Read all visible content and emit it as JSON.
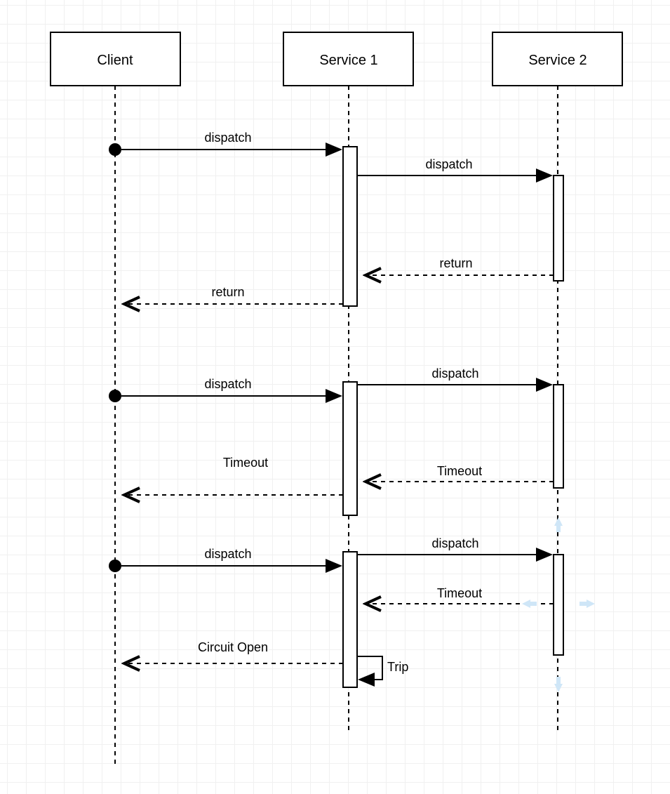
{
  "participants": {
    "client": "Client",
    "service1": "Service 1",
    "service2": "Service 2"
  },
  "messages": {
    "seq1_client_to_s1": "dispatch",
    "seq1_s1_to_s2": "dispatch",
    "seq1_s2_to_s1": "return",
    "seq1_s1_to_client": "return",
    "seq2_client_to_s1": "dispatch",
    "seq2_s1_to_s2": "dispatch",
    "seq2_s2_to_s1": "Timeout",
    "seq2_s1_to_client": "Timeout",
    "seq3_client_to_s1": "dispatch",
    "seq3_s1_to_s2": "dispatch",
    "seq3_s2_to_s1": "Timeout",
    "seq3_s1_self": "Trip",
    "seq3_s1_to_client": "Circuit Open"
  }
}
